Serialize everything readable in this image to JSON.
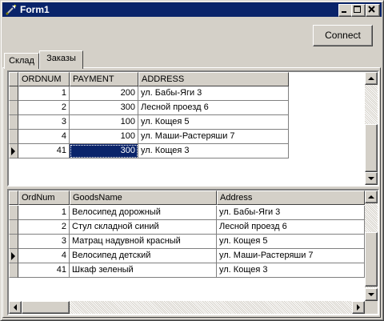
{
  "window": {
    "title": "Form1"
  },
  "toolbar": {
    "connect_label": "Connect"
  },
  "tabs": [
    {
      "label": "Склад"
    },
    {
      "label": "Заказы"
    }
  ],
  "orders_grid": {
    "columns": [
      "ORDNUM",
      "PAYMENT",
      "ADDRESS"
    ],
    "rows": [
      [
        "1",
        "200",
        "ул. Бабы-Яги 3"
      ],
      [
        "2",
        "300",
        "Лесной проезд  6"
      ],
      [
        "3",
        "100",
        "ул. Кощея 5"
      ],
      [
        "4",
        "100",
        "ул. Маши-Растеряши 7"
      ],
      [
        "41",
        "300",
        "ул. Кощея 3"
      ]
    ]
  },
  "goods_grid": {
    "columns": [
      "OrdNum",
      "GoodsName",
      "Address"
    ],
    "rows": [
      [
        "1",
        "Велосипед дорожный",
        "ул. Бабы-Яги 3"
      ],
      [
        "2",
        "Стул складной синий",
        "Лесной проезд 6"
      ],
      [
        "3",
        "Матрац надувной красный",
        "ул. Кощея 5"
      ],
      [
        "4",
        "Велосипед детский",
        "ул. Маши-Растеряши 7"
      ],
      [
        "41",
        "Шкаф зеленый",
        "ул. Кощея 3"
      ]
    ]
  }
}
